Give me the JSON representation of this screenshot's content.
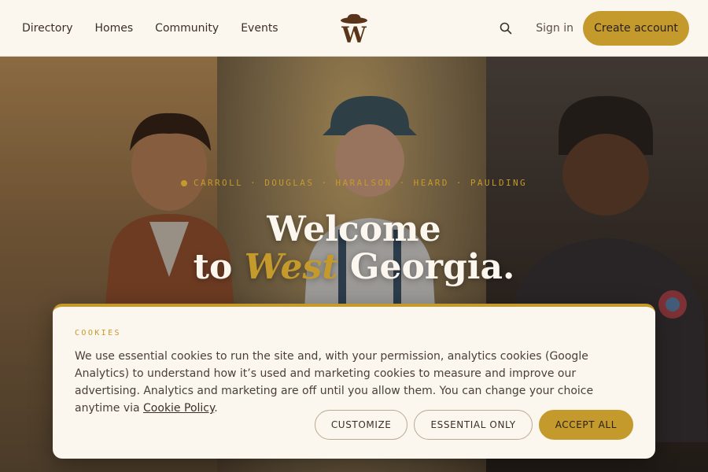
{
  "colors": {
    "accent": "#c49a2c",
    "cream": "#fbf6ee",
    "text": "#3a3026"
  },
  "header": {
    "nav": [
      "Directory",
      "Homes",
      "Community",
      "Events"
    ],
    "logo_icon": "cowboy-hat-w-logo",
    "search_icon": "search-icon",
    "sign_in": "Sign in",
    "create_account": "Create account"
  },
  "hero": {
    "regions": "CARROLL · DOUGLAS · HARALSON · HEARD · PAULDING",
    "headline_line1": "Welcome",
    "headline_to": "to",
    "headline_accent": "West",
    "headline_end": "Georgia."
  },
  "cookie": {
    "title": "COOKIES",
    "body": "We use essential cookies to run the site and, with your permission, analytics cookies (Google Analytics) to understand how it’s used and marketing cookies to measure and improve our advertising. Analytics and marketing are off until you allow them. You can change your choice anytime via ",
    "link": "Cookie Policy",
    "period": ".",
    "customize": "CUSTOMIZE",
    "essential_only": "ESSENTIAL ONLY",
    "accept_all": "ACCEPT ALL"
  }
}
